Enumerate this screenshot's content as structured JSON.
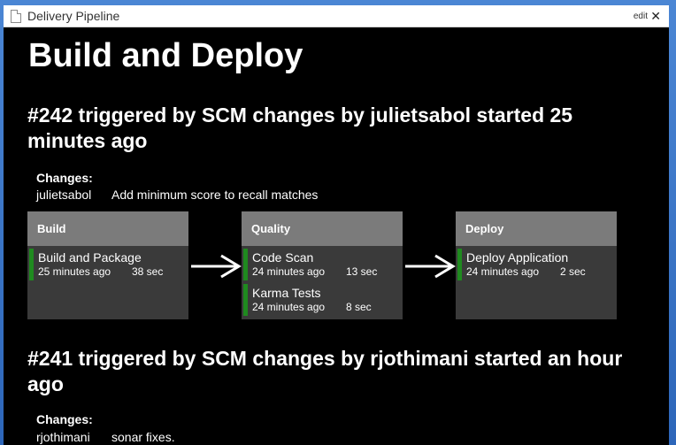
{
  "window": {
    "title": "Delivery Pipeline",
    "edit_label": "edit",
    "close_label": "✕"
  },
  "page": {
    "title": "Build and Deploy"
  },
  "runs": [
    {
      "heading": "#242 triggered by SCM changes by julietsabol started 25 minutes ago",
      "changes_label": "Changes:",
      "changes": [
        {
          "author": "julietsabol",
          "message": "Add minimum score to recall matches"
        }
      ],
      "stages": [
        {
          "name": "Build",
          "tasks": [
            {
              "name": "Build and Package",
              "time": "25 minutes ago",
              "duration": "38 sec",
              "status_color": "#1f8a1f"
            }
          ]
        },
        {
          "name": "Quality",
          "tasks": [
            {
              "name": "Code Scan",
              "time": "24 minutes ago",
              "duration": "13 sec",
              "status_color": "#1f8a1f"
            },
            {
              "name": "Karma Tests",
              "time": "24 minutes ago",
              "duration": "8 sec",
              "status_color": "#1f8a1f"
            }
          ]
        },
        {
          "name": "Deploy",
          "tasks": [
            {
              "name": "Deploy Application",
              "time": "24 minutes ago",
              "duration": "2 sec",
              "status_color": "#1f8a1f"
            }
          ]
        }
      ]
    },
    {
      "heading": "#241 triggered by SCM changes by rjothimani started an hour ago",
      "changes_label": "Changes:",
      "changes": [
        {
          "author": "rjothimani",
          "message": "sonar fixes."
        }
      ]
    }
  ],
  "icons": {
    "document": "document-icon",
    "close": "close-icon",
    "arrow": "right-arrow-icon"
  }
}
